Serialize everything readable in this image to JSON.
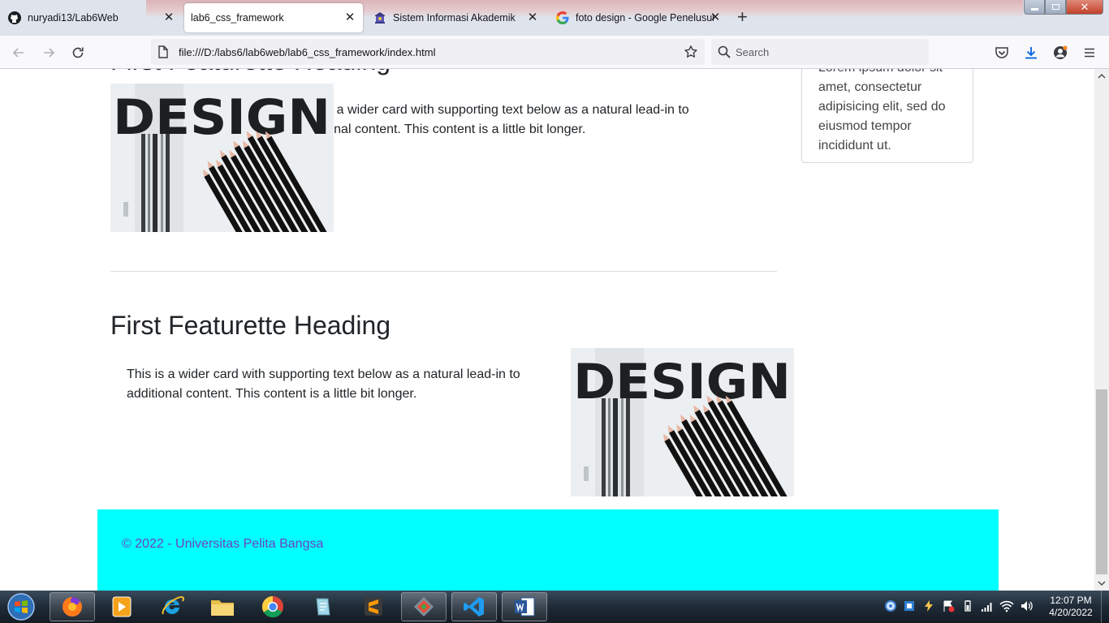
{
  "browser": {
    "tabs": [
      {
        "title": "nuryadi13/Lab6Web",
        "icon": "github-icon",
        "active": false
      },
      {
        "title": "lab6_css_framework",
        "icon": "none",
        "active": true
      },
      {
        "title": "Sistem Informasi Akademik",
        "icon": "campus-logo-icon",
        "active": false
      },
      {
        "title": "foto design - Google Penelusuran",
        "icon": "google-icon",
        "active": false
      }
    ],
    "url": "file:///D:/labs6/lab6web/lab6_css_framework/index.html",
    "search_placeholder": "Search"
  },
  "page": {
    "featurette_top": {
      "heading": "First Featurette Heading",
      "image_text": "DESIGN",
      "lead": "This is a wider card with supporting text below as a natural lead-in to additional content. This content is a little bit longer."
    },
    "sidebar_card_text": "Lorem ipsum dolor sit amet, consectetur adipisicing elit, sed do eiusmod tempor incididunt ut.",
    "featurette_bottom": {
      "heading": "First Featurette Heading",
      "image_text": "DESIGN",
      "lead": "This is a wider card with supporting text below as a natural lead-in to additional content. This content is a little bit longer."
    },
    "footer": "© 2022 - Universitas Pelita Bangsa"
  },
  "taskbar": {
    "apps": [
      "windows-start",
      "firefox",
      "media-player",
      "internet-explorer",
      "file-explorer",
      "chrome",
      "notepad",
      "sublime-text",
      "git",
      "vscode",
      "word"
    ],
    "time": "12:07 PM",
    "date": "4/20/2022"
  },
  "colors": {
    "footer_bg": "#00ffff",
    "footer_text": "#6f42c1",
    "tab_strip": "#dfe4ec"
  }
}
